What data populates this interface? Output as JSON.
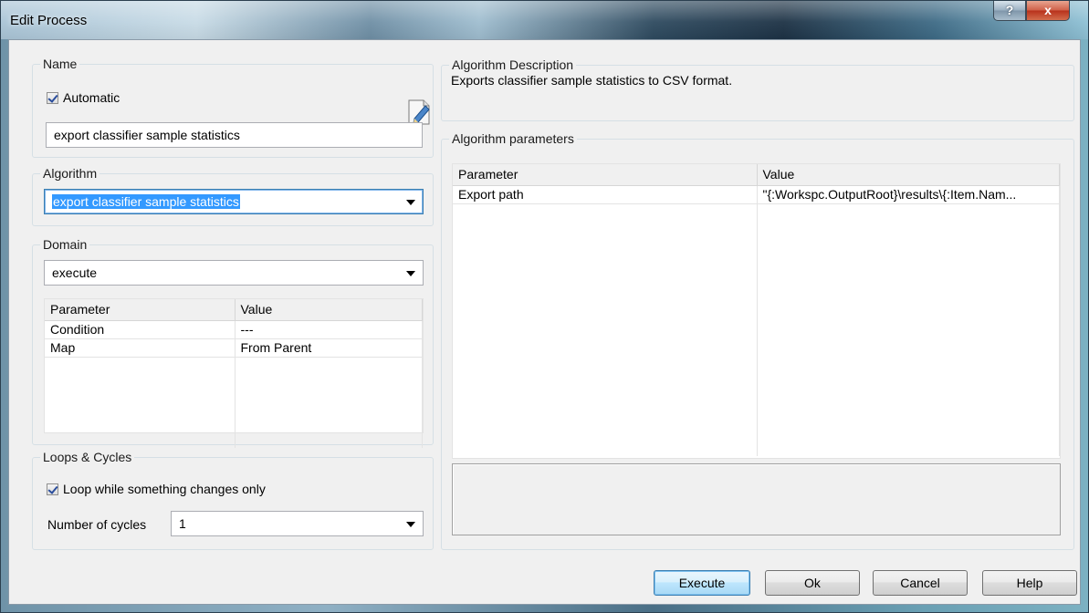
{
  "window": {
    "title": "Edit Process",
    "help_glyph": "?",
    "close_glyph": "x"
  },
  "name_group": {
    "label": "Name",
    "automatic_label": "Automatic",
    "automatic_checked": true,
    "name_value": "export classifier sample statistics"
  },
  "algorithm_group": {
    "label": "Algorithm",
    "selected": "export classifier sample statistics"
  },
  "domain_group": {
    "label": "Domain",
    "selected": "execute",
    "headers": [
      "Parameter",
      "Value"
    ],
    "rows": [
      {
        "parameter": "Condition",
        "value": "---"
      },
      {
        "parameter": "Map",
        "value": "From Parent"
      }
    ]
  },
  "loops_group": {
    "label": "Loops & Cycles",
    "loop_label": "Loop while something changes only",
    "loop_checked": true,
    "cycles_label": "Number of cycles",
    "cycles_value": "1"
  },
  "description_group": {
    "label": "Algorithm Description",
    "text": "Exports classifier sample statistics to CSV format."
  },
  "parameters_group": {
    "label": "Algorithm parameters",
    "headers": [
      "Parameter",
      "Value"
    ],
    "rows": [
      {
        "parameter": "Export path",
        "value": "\"{:Workspc.OutputRoot}\\results\\{:Item.Nam..."
      }
    ]
  },
  "buttons": {
    "execute": "Execute",
    "ok": "Ok",
    "cancel": "Cancel",
    "help": "Help"
  },
  "colors": {
    "selection": "#3399ff",
    "default_button_border": "#3c7fb1",
    "close_button": "#c7422a"
  }
}
